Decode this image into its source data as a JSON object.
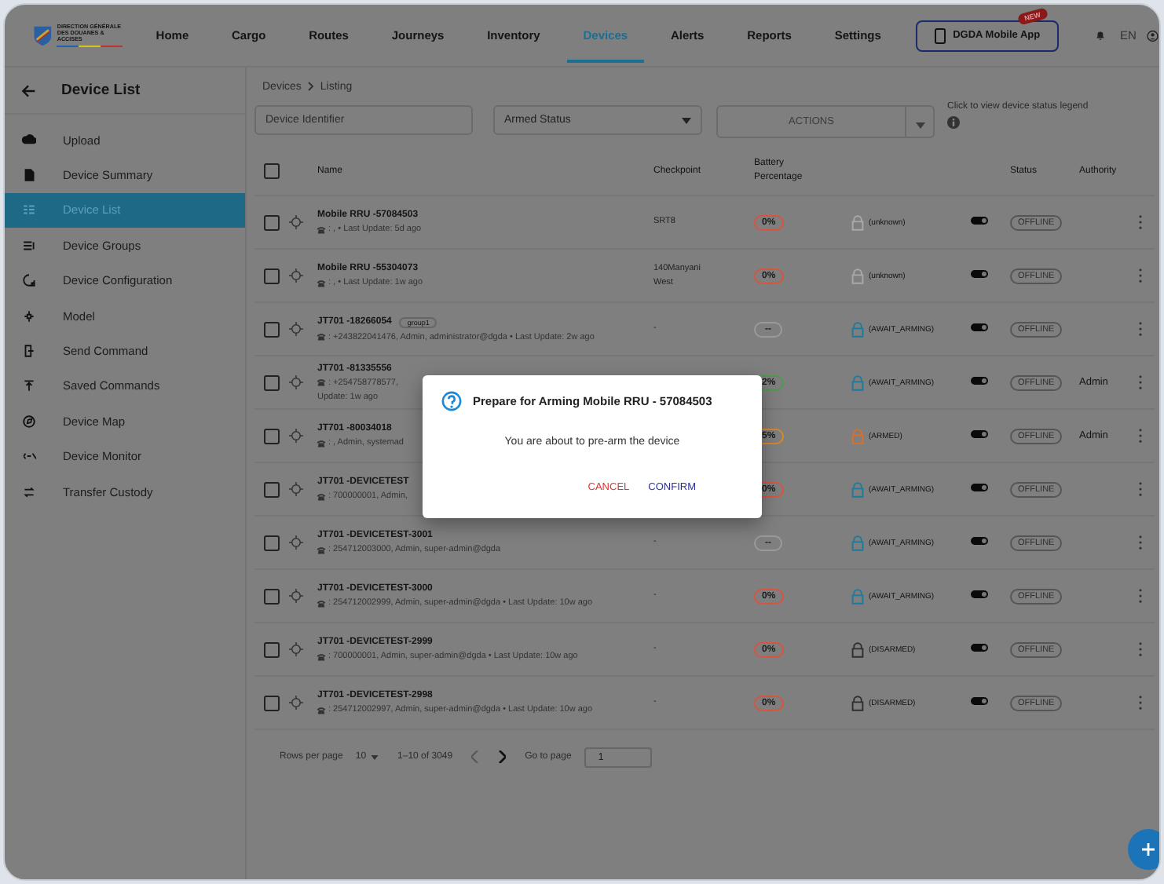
{
  "nav": {
    "logo_lines": [
      "DIRECTION GÉNÉRALE",
      "DES DOUANES & ACCISES"
    ],
    "items": [
      {
        "label": "Home",
        "selected": false
      },
      {
        "label": "Cargo",
        "selected": false
      },
      {
        "label": "Routes",
        "selected": false
      },
      {
        "label": "Journeys",
        "selected": false
      },
      {
        "label": "Inventory",
        "selected": false
      },
      {
        "label": "Devices",
        "selected": true
      },
      {
        "label": "Alerts",
        "selected": false
      },
      {
        "label": "Reports",
        "selected": false
      },
      {
        "label": "Settings",
        "selected": false
      }
    ],
    "app_button": {
      "label": "DGDA Mobile App",
      "badge": "NEW"
    },
    "language": "EN"
  },
  "sidebar": {
    "title": "Device List",
    "items": [
      {
        "label": "Upload",
        "selected": false
      },
      {
        "label": "Device Summary",
        "selected": false
      },
      {
        "label": "Device List",
        "selected": true
      },
      {
        "label": "Device Groups",
        "selected": false
      },
      {
        "label": "Device Configuration",
        "selected": false
      },
      {
        "label": "Model",
        "selected": false
      },
      {
        "label": "Send Command",
        "selected": false
      },
      {
        "label": "Saved Commands",
        "selected": false
      },
      {
        "label": "Device Map",
        "selected": false
      },
      {
        "label": "Device Monitor",
        "selected": false
      },
      {
        "label": "Transfer Custody",
        "selected": false
      }
    ]
  },
  "breadcrumb": [
    "Devices",
    "Listing"
  ],
  "select_all_checked": false,
  "filters": {
    "search_placeholder": "Device Identifier",
    "armed_status_placeholder": "Armed Status",
    "actions": {
      "label": "ACTIONS",
      "disabled": true
    },
    "legend_hint": "Click to view device status legend"
  },
  "table": {
    "columns": [
      "Name",
      "Checkpoint",
      "Battery Percentage",
      "Status",
      "Authority"
    ],
    "rows": [
      {
        "checked": false,
        "name": "Mobile RRU -57084503",
        "sub": ": , • Last Update: 5d ago",
        "checkpoint": "SRT8",
        "battery": {
          "text": "0%",
          "color": "#d9543f"
        },
        "lock": {
          "label": "(unknown)",
          "color": "#a9a9a9"
        },
        "armed_on": true,
        "status": "OFFLINE",
        "authority": ""
      },
      {
        "checked": false,
        "name": "Mobile RRU -55304073",
        "sub": ": , • Last Update: 1w ago",
        "checkpoint": "140Manyani West",
        "battery": {
          "text": "0%",
          "color": "#d9543f"
        },
        "lock": {
          "label": "(unknown)",
          "color": "#a9a9a9"
        },
        "armed_on": true,
        "status": "OFFLINE",
        "authority": ""
      },
      {
        "checked": false,
        "name": "JT701 -18266054",
        "group": "group1",
        "sub": ": +243822041476, Admin, administrator@dgda • Last Update: 2w ago",
        "checkpoint": "-",
        "battery": {
          "text": "--",
          "color": "#9a9a9a"
        },
        "lock": {
          "label": "(AWAIT_ARMING)",
          "color": "#1d7a9a"
        },
        "armed_on": true,
        "status": "OFFLINE",
        "authority": ""
      },
      {
        "checked": false,
        "name": "JT701 -81335556",
        "sub": ": +254758778577,",
        "sub_more": "Update: 1w ago",
        "checkpoint": "",
        "battery": {
          "text": "2%",
          "color": "#4f9a4f"
        },
        "lock": {
          "label": "(AWAIT_ARMING)",
          "color": "#1d7a9a"
        },
        "armed_on": true,
        "status": "OFFLINE",
        "authority": "Admin"
      },
      {
        "checked": false,
        "name": "JT701 -80034018",
        "sub": ": , Admin, systemad",
        "checkpoint": "",
        "battery": {
          "text": "5%",
          "color": "#d98a2a"
        },
        "lock": {
          "label": "(ARMED)",
          "color": "#d9702a"
        },
        "armed_on": true,
        "status": "OFFLINE",
        "authority": "Admin"
      },
      {
        "checked": false,
        "name": "JT701 -DEVICETEST",
        "sub": ": 700000001, Admin,",
        "checkpoint": "",
        "battery": {
          "text": "0%",
          "color": "#d9543f"
        },
        "lock": {
          "label": "(AWAIT_ARMING)",
          "color": "#1d7a9a"
        },
        "armed_on": true,
        "status": "OFFLINE",
        "authority": ""
      },
      {
        "checked": false,
        "name": "JT701 -DEVICETEST-3001",
        "sub": ": 254712003000, Admin, super-admin@dgda",
        "checkpoint": "-",
        "battery": {
          "text": "--",
          "color": "#9a9a9a"
        },
        "lock": {
          "label": "(AWAIT_ARMING)",
          "color": "#1d7a9a"
        },
        "armed_on": true,
        "status": "OFFLINE",
        "authority": ""
      },
      {
        "checked": false,
        "name": "JT701 -DEVICETEST-3000",
        "sub": ": 254712002999, Admin, super-admin@dgda • Last Update: 10w ago",
        "checkpoint": "-",
        "battery": {
          "text": "0%",
          "color": "#d9543f"
        },
        "lock": {
          "label": "(AWAIT_ARMING)",
          "color": "#1d7a9a"
        },
        "armed_on": true,
        "status": "OFFLINE",
        "authority": ""
      },
      {
        "checked": false,
        "name": "JT701 -DEVICETEST-2999",
        "sub": ": 700000001, Admin, super-admin@dgda • Last Update: 10w ago",
        "checkpoint": "-",
        "battery": {
          "text": "0%",
          "color": "#d9543f"
        },
        "lock": {
          "label": "(DISARMED)",
          "color": "#2f2f2f"
        },
        "armed_on": true,
        "status": "OFFLINE",
        "authority": ""
      },
      {
        "checked": false,
        "name": "JT701 -DEVICETEST-2998",
        "sub": ": 254712002997, Admin, super-admin@dgda • Last Update: 10w ago",
        "checkpoint": "-",
        "battery": {
          "text": "0%",
          "color": "#d9543f"
        },
        "lock": {
          "label": "(DISARMED)",
          "color": "#2f2f2f"
        },
        "armed_on": true,
        "status": "OFFLINE",
        "authority": ""
      }
    ]
  },
  "pagination": {
    "rows_per_page_label": "Rows per page",
    "rows_per_page": "10",
    "range": "1–10 of 3049",
    "go_to_label": "Go to page",
    "page": "1"
  },
  "dialog": {
    "title": "Prepare for Arming Mobile RRU - 57084503",
    "message": "You are about to pre-arm the device",
    "cancel": "CANCEL",
    "confirm": "CONFIRM"
  }
}
